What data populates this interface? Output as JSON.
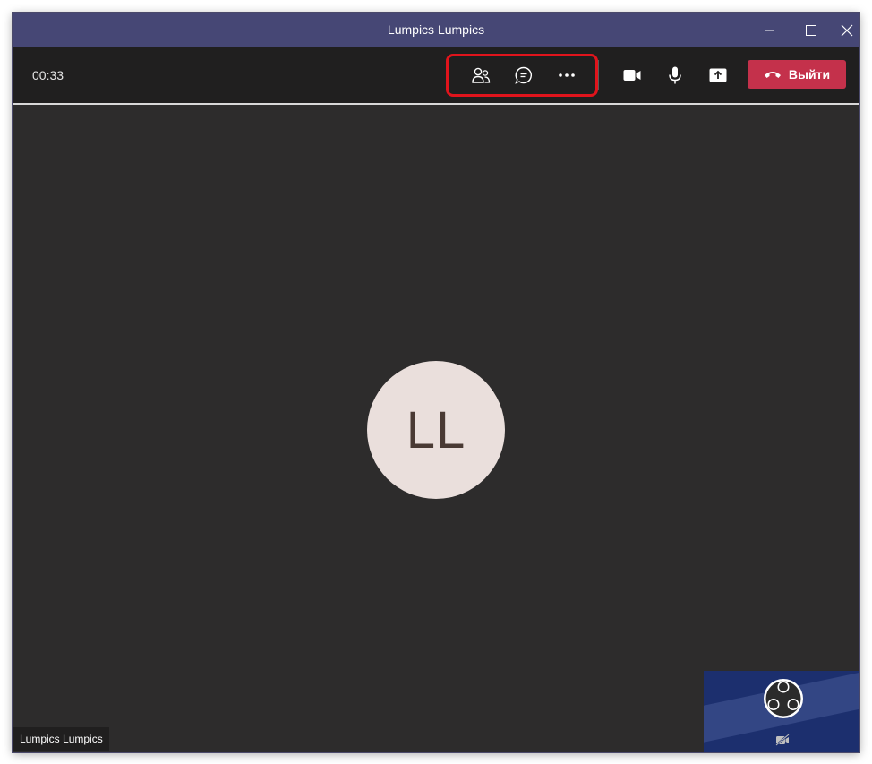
{
  "window": {
    "title": "Lumpics Lumpics"
  },
  "call": {
    "timer": "00:33",
    "leave_label": "Выйти",
    "avatar_initials": "LL",
    "participant_name": "Lumpics Lumpics"
  },
  "icons": {
    "participants": "people-icon",
    "chat": "chat-icon",
    "more": "more-icon",
    "camera": "video-camera-icon",
    "mic": "microphone-icon",
    "share": "share-screen-icon",
    "hangup": "phone-hangup-icon",
    "self_video": "obs-logo-icon",
    "camera_off": "camera-off-icon"
  },
  "colors": {
    "titlebar": "#464775",
    "toolbar": "#201f1f",
    "stage": "#2d2c2c",
    "leave_button": "#c4314b",
    "highlight": "#e0141c",
    "avatar_bg": "#eadfdc"
  }
}
